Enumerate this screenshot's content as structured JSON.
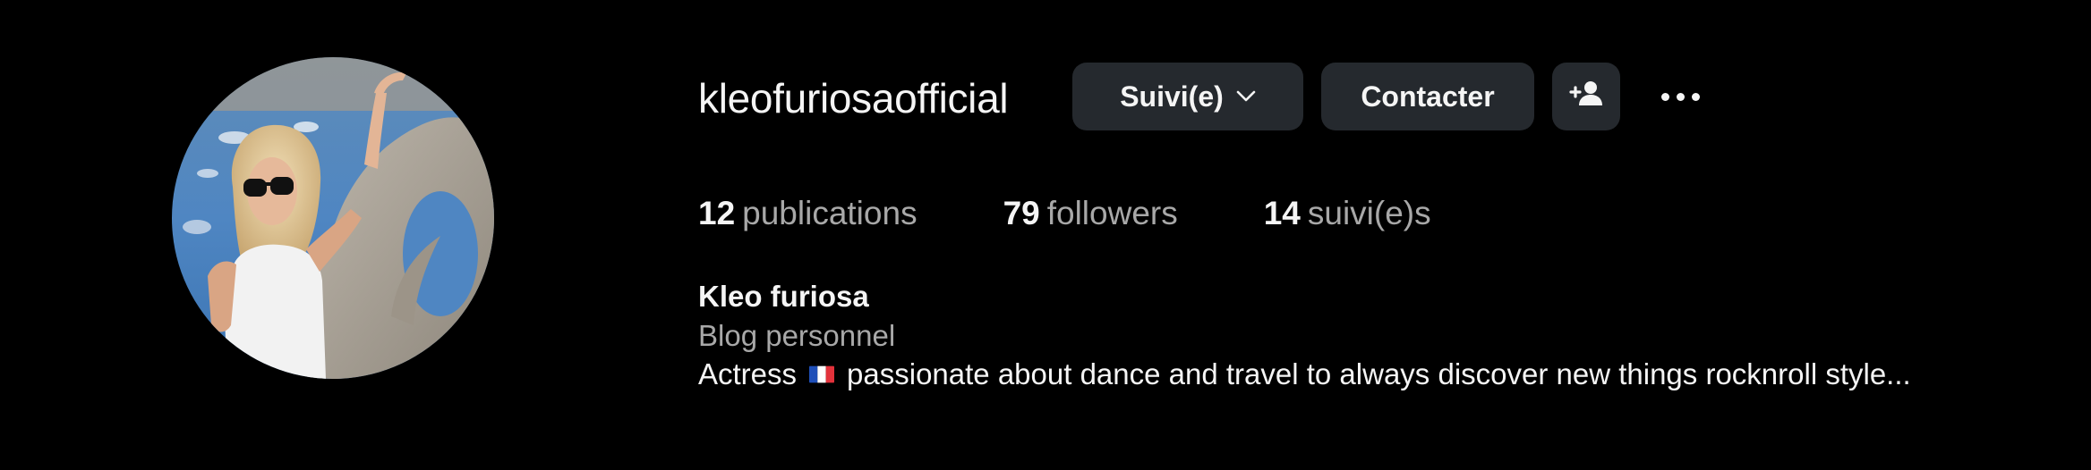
{
  "profile": {
    "username": "kleofuriosaofficial",
    "display_name": "Kleo furiosa",
    "category": "Blog personnel",
    "bio_before_flag": "Actress",
    "bio_flag_icon": "france-flag-icon",
    "bio_after_flag": "passionate about dance and travel to always discover new things rocknroll style..."
  },
  "actions": {
    "follow_label": "Suivi(e)",
    "contact_label": "Contacter",
    "add_user_icon": "person-add-icon",
    "more_icon": "more-options-icon"
  },
  "stats": [
    {
      "count": "12",
      "label": "publications"
    },
    {
      "count": "79",
      "label": "followers"
    },
    {
      "count": "14",
      "label": "suivi(e)s"
    }
  ],
  "colors": {
    "background": "#000000",
    "button_bg": "#25292e",
    "text_primary": "#f5f5f5",
    "text_secondary": "#a8a8a8"
  }
}
